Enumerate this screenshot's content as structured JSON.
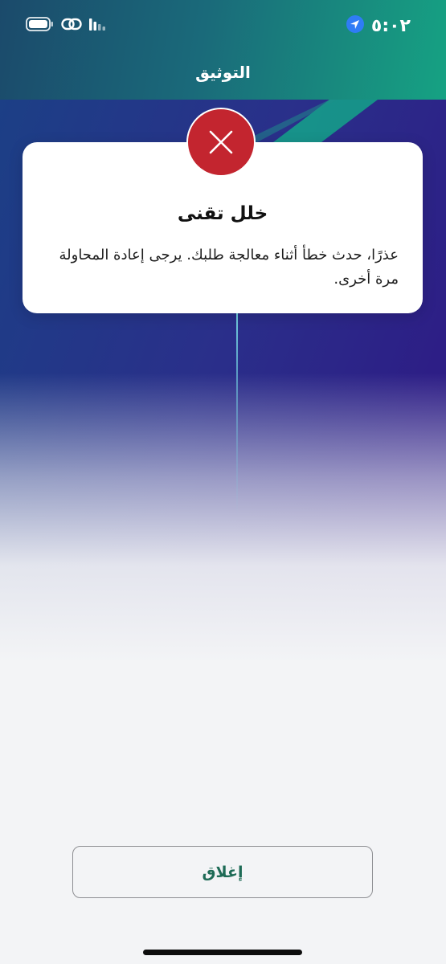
{
  "status_bar": {
    "time": "٥:٠٢",
    "location_icon": "location-arrow-icon",
    "signal_icon": "cellular-signal-icon",
    "link_icon": "link-icon",
    "battery_icon": "battery-icon"
  },
  "header": {
    "title": "التوثيق"
  },
  "dialog": {
    "icon": "error-x-icon",
    "title": "خلل تقنى",
    "message": "عذرًا، حدث خطأ أثناء معالجة طلبك. يرجى إعادة المحاولة مرة أخرى."
  },
  "actions": {
    "close_label": "إغلاق"
  },
  "colors": {
    "error_red": "#c3252f",
    "button_text_green": "#1e6b56",
    "header_teal": "#18897e",
    "background_indigo": "#2d1e86"
  }
}
